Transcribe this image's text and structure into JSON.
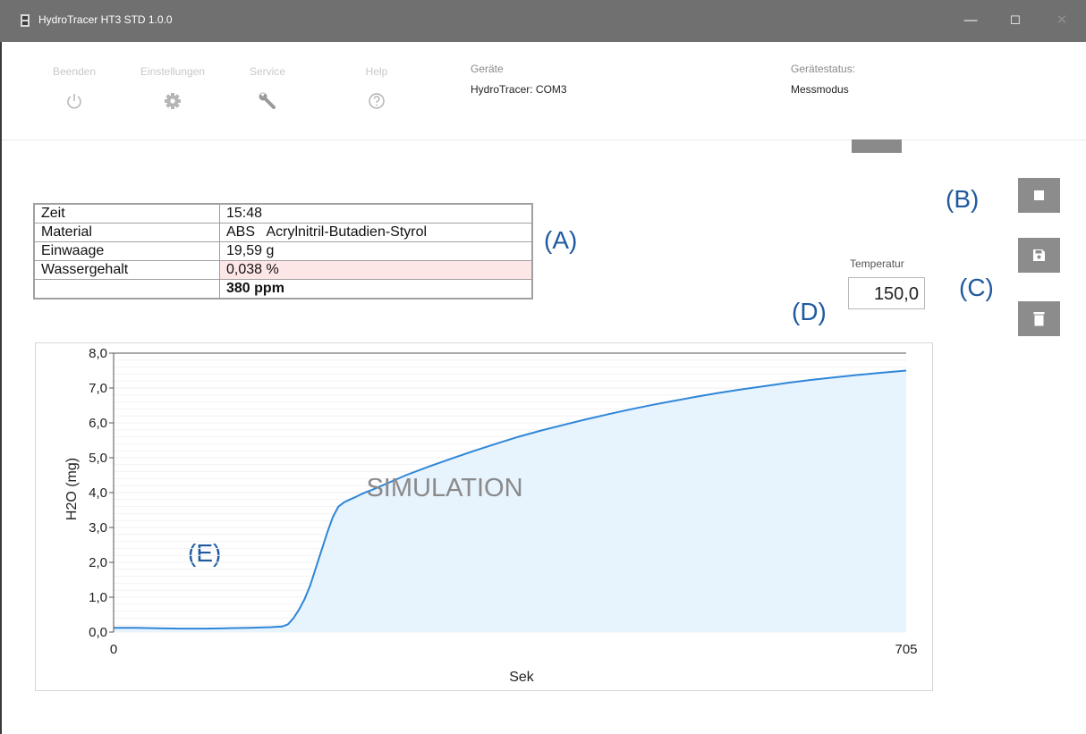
{
  "window": {
    "title": "HydroTracer HT3 STD 1.0.0",
    "minimize": "—",
    "maximize": "☐",
    "close": "✕"
  },
  "toolbar": {
    "items": [
      {
        "label": "Beenden",
        "icon": "power-icon"
      },
      {
        "label": "Einstellungen",
        "icon": "gear-icon"
      },
      {
        "label": "Service",
        "icon": "wrench-icon"
      },
      {
        "label": "Help",
        "icon": "help-icon"
      }
    ],
    "devices_label": "Geräte",
    "devices_value": "HydroTracer: COM3",
    "status_label": "Gerätestatus:",
    "status_value": "Messmodus"
  },
  "table": {
    "rows": [
      {
        "label": "Zeit",
        "value": "15:48"
      },
      {
        "label": "Material",
        "value": "ABS   Acrylnitril-Butadien-Styrol"
      },
      {
        "label": "Einwaage",
        "value": "19,59 g"
      },
      {
        "label": "Wassergehalt",
        "value": "0,038 %"
      },
      {
        "label": "",
        "value": "380 ppm"
      }
    ]
  },
  "markers": {
    "a": "(A)",
    "b": "(B)",
    "c": "(C)",
    "d": "(D)",
    "e": "(E)"
  },
  "side_buttons": [
    {
      "name": "stop-button",
      "icon": "stop-icon"
    },
    {
      "name": "save-button",
      "icon": "floppy-icon"
    },
    {
      "name": "delete-button",
      "icon": "trash-icon"
    }
  ],
  "temperature": {
    "label": "Temperatur",
    "value": "150,0"
  },
  "colors": {
    "line": "#2f86d8",
    "fill": "#e7f3fd",
    "marker": "#1f5aa0",
    "titlebar": "#707070"
  },
  "chart_data": {
    "type": "area",
    "watermark": "SIMULATION",
    "xlabel": "Sek",
    "ylabel": "H2O (mg)",
    "xlim": [
      0,
      705
    ],
    "ylim": [
      0,
      8
    ],
    "x_tick_labels": [
      "0",
      "705"
    ],
    "y_tick_labels": [
      "0,0",
      "1,0",
      "2,0",
      "3,0",
      "4,0",
      "5,0",
      "6,0",
      "7,0",
      "8,0"
    ],
    "grid": "horizontal",
    "series": [
      {
        "x": [
          0,
          20,
          40,
          60,
          80,
          100,
          120,
          140,
          150,
          155,
          160,
          165,
          170,
          175,
          180,
          185,
          190,
          195,
          200,
          205,
          210,
          215,
          220,
          225,
          230,
          240,
          250,
          260,
          280,
          300,
          320,
          340,
          360,
          380,
          400,
          420,
          440,
          460,
          480,
          500,
          520,
          540,
          560,
          580,
          600,
          620,
          640,
          660,
          680,
          705
        ],
        "y": [
          0.12,
          0.12,
          0.11,
          0.1,
          0.1,
          0.11,
          0.12,
          0.14,
          0.16,
          0.22,
          0.4,
          0.65,
          0.95,
          1.35,
          1.85,
          2.35,
          2.85,
          3.3,
          3.6,
          3.72,
          3.8,
          3.87,
          3.95,
          4.02,
          4.08,
          4.22,
          4.36,
          4.5,
          4.74,
          4.97,
          5.19,
          5.4,
          5.6,
          5.78,
          5.94,
          6.1,
          6.25,
          6.39,
          6.52,
          6.64,
          6.76,
          6.87,
          6.97,
          7.06,
          7.15,
          7.23,
          7.3,
          7.37,
          7.43,
          7.5
        ]
      }
    ]
  }
}
